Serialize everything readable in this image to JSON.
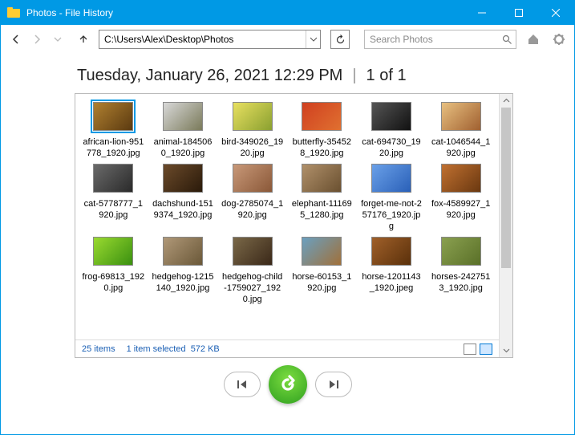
{
  "window": {
    "title": "Photos - File History"
  },
  "toolbar": {
    "path": "C:\\Users\\Alex\\Desktop\\Photos",
    "search_placeholder": "Search Photos"
  },
  "header": {
    "timestamp": "Tuesday, January 26, 2021 12:29 PM",
    "separator": "|",
    "pager": "1 of 1"
  },
  "items": [
    {
      "label": "african-lion-951778_1920.jpg",
      "cls": "g-lion",
      "selected": true
    },
    {
      "label": "animal-1845060_1920.jpg",
      "cls": "g-owl",
      "selected": false
    },
    {
      "label": "bird-349026_1920.jpg",
      "cls": "g-bird",
      "selected": false
    },
    {
      "label": "butterfly-354528_1920.jpg",
      "cls": "g-butterfly",
      "selected": false
    },
    {
      "label": "cat-694730_1920.jpg",
      "cls": "g-catbw",
      "selected": false
    },
    {
      "label": "cat-1046544_1920.jpg",
      "cls": "g-cat2",
      "selected": false
    },
    {
      "label": "cat-5778777_1920.jpg",
      "cls": "g-cat3",
      "selected": false
    },
    {
      "label": "dachshund-1519374_1920.jpg",
      "cls": "g-dachs",
      "selected": false
    },
    {
      "label": "dog-2785074_1920.jpg",
      "cls": "g-dog",
      "selected": false
    },
    {
      "label": "elephant-111695_1280.jpg",
      "cls": "g-eleph",
      "selected": false
    },
    {
      "label": "forget-me-not-257176_1920.jpg",
      "cls": "g-forget",
      "selected": false
    },
    {
      "label": "fox-4589927_1920.jpg",
      "cls": "g-fox",
      "selected": false
    },
    {
      "label": "frog-69813_1920.jpg",
      "cls": "g-frog",
      "selected": false
    },
    {
      "label": "hedgehog-1215140_1920.jpg",
      "cls": "g-hedge1",
      "selected": false
    },
    {
      "label": "hedgehog-child-1759027_1920.jpg",
      "cls": "g-hedge2",
      "selected": false
    },
    {
      "label": "horse-60153_1920.jpg",
      "cls": "g-horse1",
      "selected": false
    },
    {
      "label": "horse-1201143_1920.jpeg",
      "cls": "g-horse2",
      "selected": false
    },
    {
      "label": "horses-2427513_1920.jpg",
      "cls": "g-horses",
      "selected": false
    }
  ],
  "status": {
    "count": "25 items",
    "selection": "1 item selected",
    "size": "572 KB"
  }
}
